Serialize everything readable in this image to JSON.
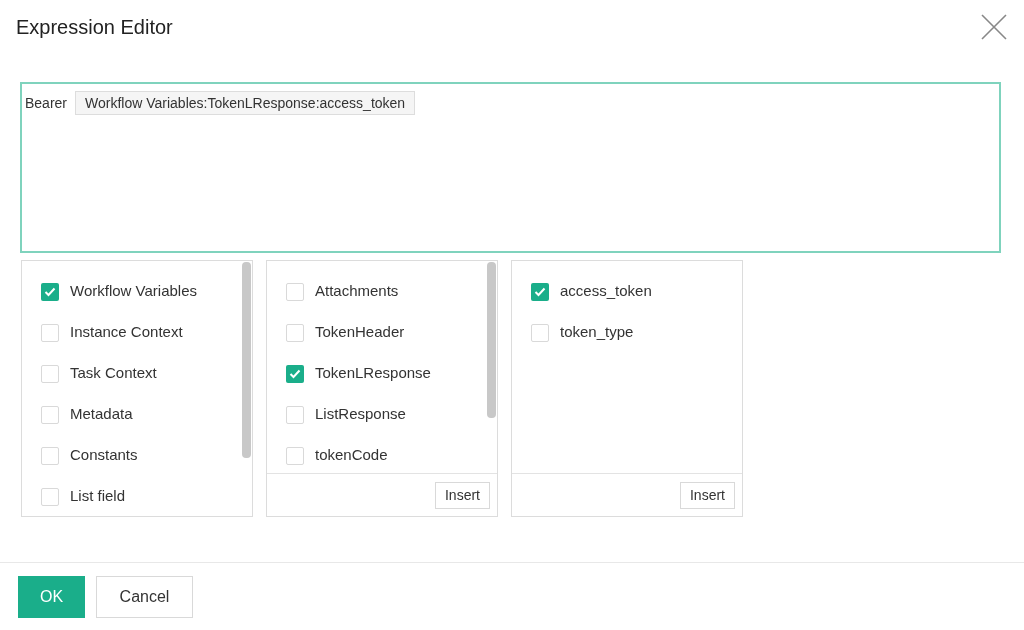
{
  "dialog": {
    "title": "Expression Editor"
  },
  "expression": {
    "text": "Bearer",
    "token": "Workflow Variables:TokenLResponse:access_token"
  },
  "panels": [
    {
      "items": [
        {
          "label": "Workflow Variables",
          "checked": true
        },
        {
          "label": "Instance Context",
          "checked": false
        },
        {
          "label": "Task Context",
          "checked": false
        },
        {
          "label": "Metadata",
          "checked": false
        },
        {
          "label": "Constants",
          "checked": false
        },
        {
          "label": "List field",
          "checked": false
        }
      ]
    },
    {
      "items": [
        {
          "label": "Attachments",
          "checked": false
        },
        {
          "label": "TokenHeader",
          "checked": false
        },
        {
          "label": "TokenLResponse",
          "checked": true
        },
        {
          "label": "ListResponse",
          "checked": false
        },
        {
          "label": "tokenCode",
          "checked": false
        }
      ],
      "button": "Insert"
    },
    {
      "items": [
        {
          "label": "access_token",
          "checked": true
        },
        {
          "label": "token_type",
          "checked": false
        }
      ],
      "button": "Insert"
    }
  ],
  "buttons": {
    "ok": "OK",
    "cancel": "Cancel"
  }
}
